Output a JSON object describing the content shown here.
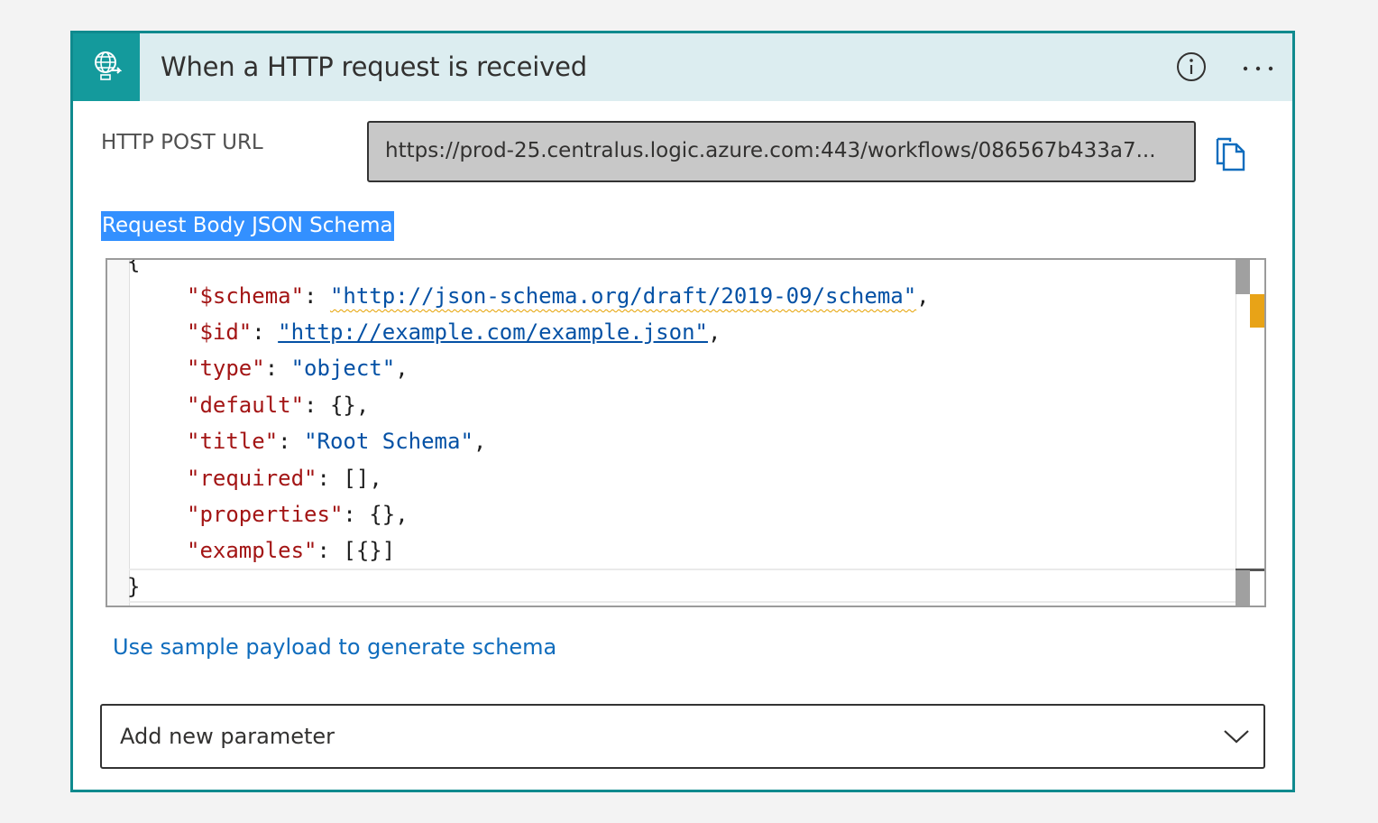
{
  "header": {
    "title": "When a HTTP request is received",
    "trigger_icon": "globe-request-icon",
    "info_icon": "info-icon",
    "more_icon": "more-options-icon"
  },
  "url": {
    "label": "HTTP POST URL",
    "value": "https://prod-25.centralus.logic.azure.com:443/workflows/086567b433a7...",
    "copy_icon": "copy-icon"
  },
  "schema": {
    "label": "Request Body JSON Schema",
    "open_brace": "{",
    "close_brace": "}",
    "lines": [
      {
        "key": "\"$schema\"",
        "sep": ": ",
        "value": "\"http://json-schema.org/draft/2019-09/schema\"",
        "end": ","
      },
      {
        "key": "\"$id\"",
        "sep": ": ",
        "value": "\"http://example.com/example.json\"",
        "end": ","
      },
      {
        "key": "\"type\"",
        "sep": ": ",
        "value": "\"object\"",
        "end": ","
      },
      {
        "key": "\"default\"",
        "sep": ": ",
        "value": "{}",
        "end": ","
      },
      {
        "key": "\"title\"",
        "sep": ": ",
        "value": "\"Root Schema\"",
        "end": ","
      },
      {
        "key": "\"required\"",
        "sep": ": ",
        "value": "[]",
        "end": ","
      },
      {
        "key": "\"properties\"",
        "sep": ": ",
        "value": "{}",
        "end": ","
      },
      {
        "key": "\"examples\"",
        "sep": ": ",
        "value": "[{}]",
        "end": ""
      }
    ]
  },
  "sample_link": "Use sample payload to generate schema",
  "add_parameter": {
    "placeholder": "Add new parameter",
    "chevron_icon": "chevron-down-icon"
  },
  "colors": {
    "accent": "#149a9c",
    "border": "#0f8a8e",
    "header_bg": "#dcedf0",
    "link": "#0f6cbd",
    "json_key": "#a31515",
    "json_string": "#0451a5",
    "selection": "#3390ff"
  }
}
